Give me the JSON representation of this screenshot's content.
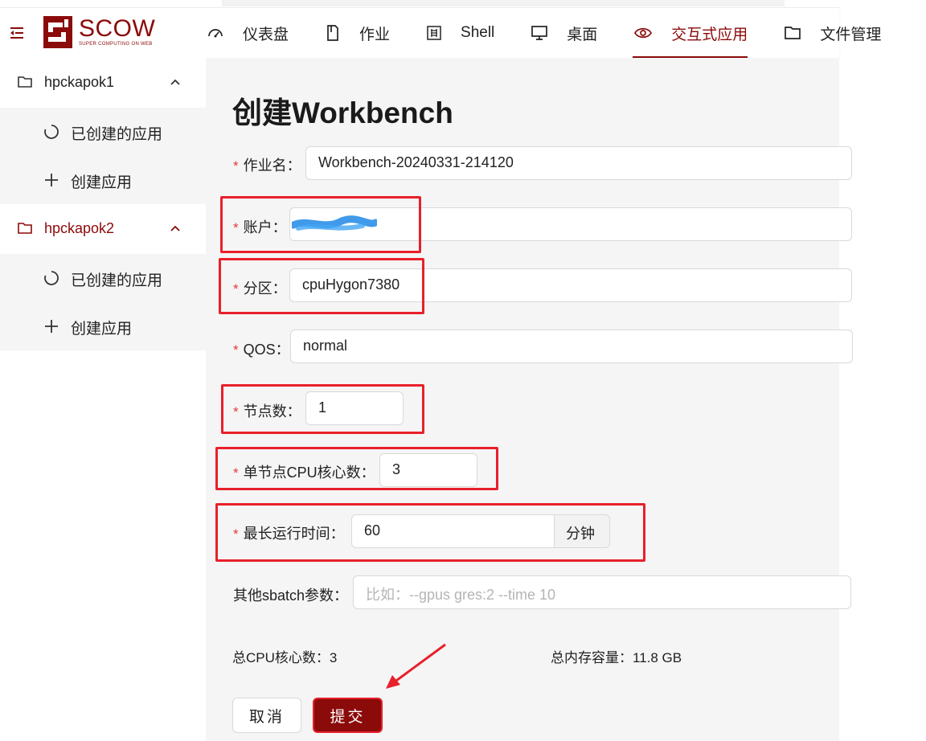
{
  "brand": {
    "name": "SCOW",
    "tagline": "SUPER COMPUTING ON WEB",
    "accent": "#8b0a0a"
  },
  "nav": [
    {
      "label": "仪表盘",
      "icon": "dashboard-icon"
    },
    {
      "label": "作业",
      "icon": "job-icon"
    },
    {
      "label": "Shell",
      "icon": "terminal-icon"
    },
    {
      "label": "桌面",
      "icon": "desktop-icon"
    },
    {
      "label": "交互式应用",
      "icon": "eye-icon",
      "active": true
    },
    {
      "label": "文件管理",
      "icon": "folder-icon"
    }
  ],
  "sidebar": {
    "clusters": [
      {
        "name": "hpckapok1",
        "items": [
          {
            "label": "已创建的应用"
          },
          {
            "label": "创建应用"
          }
        ]
      },
      {
        "name": "hpckapok2",
        "active": true,
        "items": [
          {
            "label": "已创建的应用"
          },
          {
            "label": "创建应用"
          }
        ]
      }
    ]
  },
  "form": {
    "title": "创建Workbench",
    "job_name": {
      "label": "作业名",
      "value": "Workbench-20240331-214120"
    },
    "account": {
      "label": "账户",
      "value": ""
    },
    "partition": {
      "label": "分区",
      "value": "cpuHygon7380"
    },
    "qos": {
      "label": "QOS",
      "value": "normal"
    },
    "nodes": {
      "label": "节点数",
      "value": "1"
    },
    "cores": {
      "label": "单节点CPU核心数",
      "value": "3"
    },
    "max_time": {
      "label": "最长运行时间",
      "value": "60",
      "unit": "分钟"
    },
    "sbatch": {
      "label": "其他sbatch参数",
      "placeholder": "比如：--gpus gres:2 --time 10"
    },
    "colon": "：",
    "summary": {
      "total_cpu": "总CPU核心数：3",
      "total_mem": "总内存容量：11.8 GB"
    },
    "cancel_label": "取消",
    "submit_label": "提交"
  },
  "colors": {
    "annotation_red": "#e8202a",
    "required_star": "#e03a3a",
    "main_bg": "#f5f5f5"
  }
}
